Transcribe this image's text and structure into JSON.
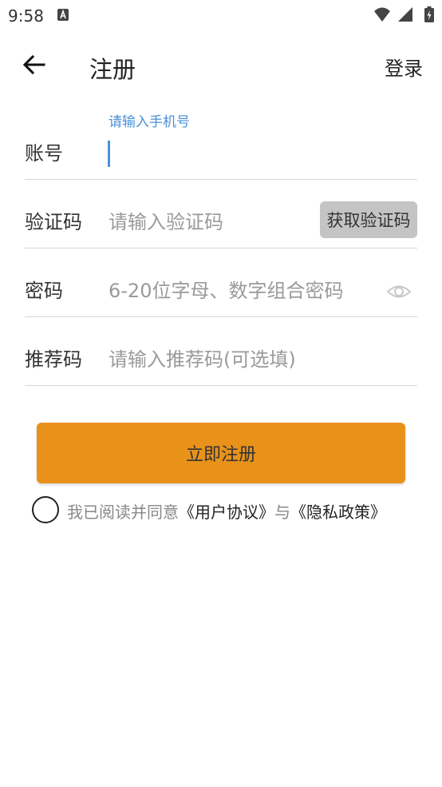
{
  "status_bar": {
    "time": "9:58",
    "icons": [
      "a-notification-icon",
      "wifi-icon",
      "signal-icon",
      "battery-icon"
    ]
  },
  "header": {
    "title": "注册",
    "login_label": "登录",
    "back_icon": "arrow-left-icon"
  },
  "form": {
    "account": {
      "label": "账号",
      "hint": "请输入手机号",
      "value": ""
    },
    "code": {
      "label": "验证码",
      "placeholder": "请输入验证码",
      "button_label": "获取验证码"
    },
    "password": {
      "label": "密码",
      "placeholder": "6-20位字母、数字组合密码",
      "visibility_icon": "eye-icon"
    },
    "referral": {
      "label": "推荐码",
      "placeholder": "请输入推荐码(可选填)"
    }
  },
  "register_button": {
    "label": "立即注册",
    "color": "#e8921a"
  },
  "agreement": {
    "checked": false,
    "prefix": "我已阅读并同意",
    "user_agreement": "《用户协议》",
    "conjunction": "与",
    "privacy_policy": "《隐私政策》"
  },
  "colors": {
    "accent_blue": "#4a90d9",
    "button_gray": "#c4c4c4",
    "divider": "#d6d6d6"
  }
}
